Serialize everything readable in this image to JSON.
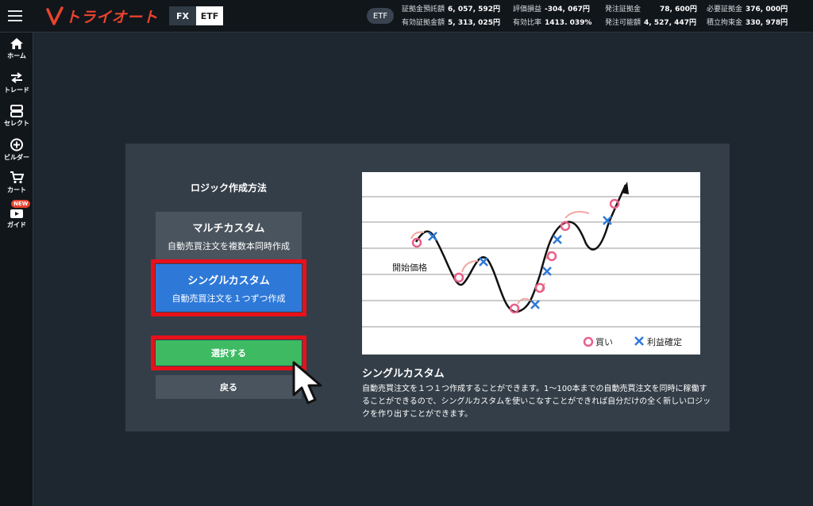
{
  "header": {
    "logo_text": "トライオート",
    "mode_fx": "FX",
    "mode_etf": "ETF",
    "etf_badge": "ETF",
    "account": [
      {
        "label": "証拠金預託額",
        "value": "6, 057, 592円"
      },
      {
        "label": "有効証拠金額",
        "value": "5, 313, 025円"
      },
      {
        "label": "評価損益",
        "value": "-304, 067円"
      },
      {
        "label": "有効比率",
        "value": "1413. 039%"
      },
      {
        "label": "発注証拠金",
        "value": "78, 600円"
      },
      {
        "label": "発注可能額",
        "value": "4, 527, 447円"
      },
      {
        "label": "必要証拠金",
        "value": "376, 000円"
      },
      {
        "label": "積立拘束金",
        "value": "330, 978円"
      }
    ]
  },
  "sidebar": {
    "items": [
      {
        "label": "ホーム",
        "icon": "home-icon"
      },
      {
        "label": "トレード",
        "icon": "trade-arrows-icon"
      },
      {
        "label": "セレクト",
        "icon": "select-icon"
      },
      {
        "label": "ビルダー",
        "icon": "plus-circle-icon"
      },
      {
        "label": "カート",
        "icon": "cart-icon"
      },
      {
        "label": "ガイド",
        "icon": "guide-tv-icon",
        "badge": "NEW"
      }
    ]
  },
  "dialog": {
    "title": "ロジック作成方法",
    "multi": {
      "title": "マルチカスタム",
      "sub": "自動売買注文を複数本同時作成"
    },
    "single": {
      "title": "シングルカスタム",
      "sub": "自動売買注文を１つずつ作成"
    },
    "select_label": "選択する",
    "back_label": "戻る",
    "diagram": {
      "start_label": "開始価格",
      "legend_buy": "買い",
      "legend_profit": "利益確定"
    },
    "desc_title": "シングルカスタム",
    "desc_text": "自動売買注文を１つ１つ作成することができます。1〜100本までの自動売買注文を同時に稼働することができるので、シングルカスタムを使いこなすことができれば自分だけの全く新しいロジックを作り出すことができます。"
  },
  "colors": {
    "accent_red": "#e8101a",
    "single_blue": "#2e79d8",
    "select_green": "#3dba62",
    "buy_pink": "#e8608a",
    "profit_blue": "#2e79d8"
  }
}
